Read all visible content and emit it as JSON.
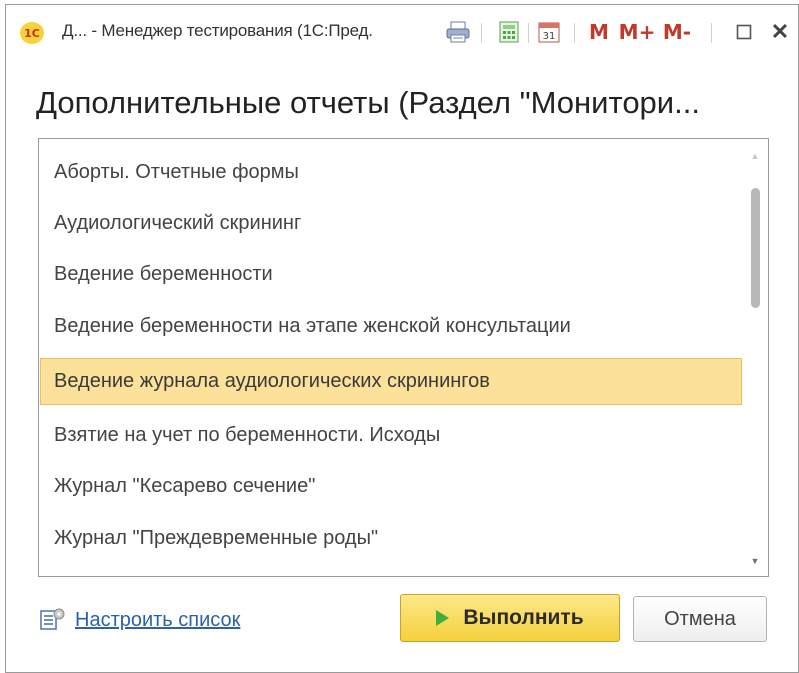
{
  "titlebar": {
    "app_logo_text": "1С",
    "title": "Д... - Менеджер тестирования (1С:Пред.",
    "m_label": "M",
    "m_plus_label": "M+",
    "m_minus_label": "M-",
    "calendar_label": "31",
    "close_label": "✕"
  },
  "heading": "Дополнительные отчеты (Раздел \"Монитори...",
  "list": {
    "items": [
      "Аборты. Отчетные формы",
      "Аудиологический скрининг",
      "Ведение беременности",
      "Ведение беременности на этапе женской консультации",
      "Ведение журнала аудиологических скринингов",
      "Взятие на учет по беременности. Исходы",
      "Журнал \"Кесарево сечение\"",
      "Журнал \"Преждевременные роды\""
    ],
    "selected": "Ведение журнала аудиологических скринингов",
    "scroll_up_glyph": "▲",
    "scroll_down_glyph": "▼"
  },
  "footer": {
    "configure_label": "Настроить список",
    "run_label": "Выполнить",
    "cancel_label": "Отмена"
  },
  "colors": {
    "selected_row": "#fbe19a",
    "primary_button": "#f5cf3c",
    "link": "#2a62a8",
    "play": "#3fae3b"
  }
}
